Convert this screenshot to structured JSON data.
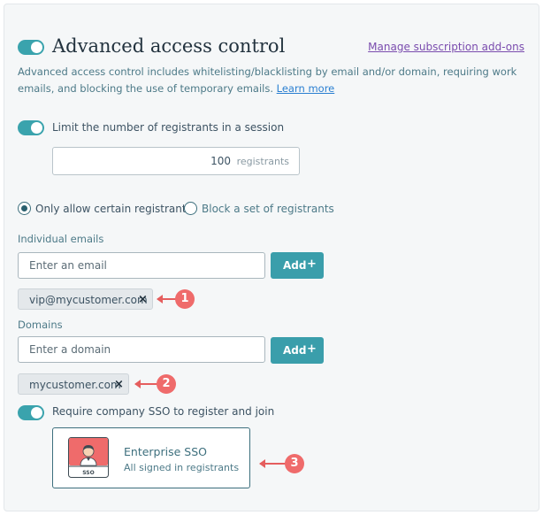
{
  "header": {
    "title": "Advanced access control",
    "manage_link": "Manage subscription add-ons",
    "description": "Advanced access control includes whitelisting/blacklisting by email and/or domain, requiring work emails, and blocking the use of temporary emails.",
    "learn_more": "Learn more",
    "toggle_on": true
  },
  "limit": {
    "label": "Limit the number of registrants in a session",
    "value": "100",
    "unit": "registrants",
    "toggle_on": true
  },
  "mode": {
    "options": [
      {
        "label": "Only allow certain registrants",
        "selected": true
      },
      {
        "label": "Block a set of registrants",
        "selected": false
      }
    ]
  },
  "emails": {
    "label": "Individual emails",
    "placeholder": "Enter an email",
    "add_label": "Add",
    "add_icon": "+",
    "chips": [
      {
        "text": "vip@mycustomer.com",
        "remove": "×"
      }
    ]
  },
  "domains": {
    "label": "Domains",
    "placeholder": "Enter a domain",
    "add_label": "Add",
    "add_icon": "+",
    "chips": [
      {
        "text": "mycustomer.com",
        "remove": "×"
      }
    ]
  },
  "sso": {
    "label": "Require company SSO to register and join",
    "toggle_on": true,
    "card": {
      "title": "Enterprise SSO",
      "subtitle": "All signed in registrants",
      "logo_text": "SSO"
    }
  },
  "callouts": [
    "1",
    "2",
    "3"
  ],
  "colors": {
    "accent": "#3aa3ad",
    "button": "#3a9eab",
    "link": "#2a7fd1",
    "manage_link": "#7a4cae",
    "callout": "#ef6b6b",
    "panel": "#f5f7f8"
  }
}
